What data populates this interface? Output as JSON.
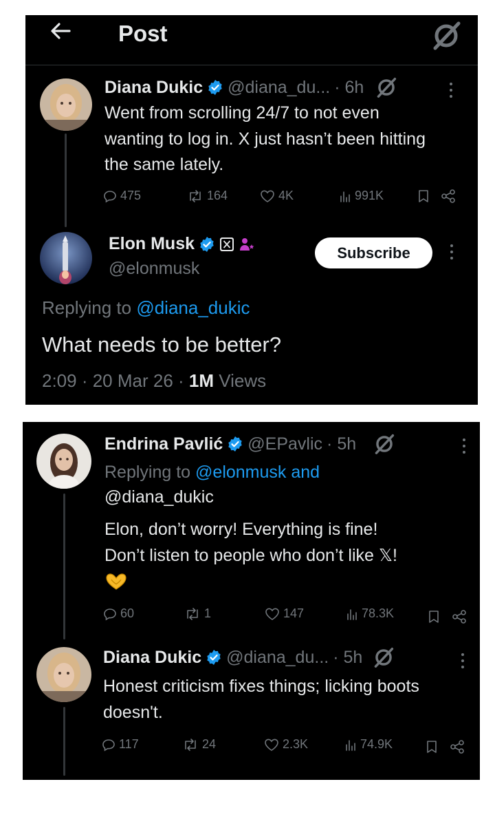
{
  "header": {
    "back_label": "←",
    "title": "Post"
  },
  "tweet1": {
    "name": "Diana Dukic",
    "handle": "@diana_du...",
    "time": "· 6h",
    "text": "Went from scrolling 24/7 to not even wanting to log in. X just hasn’t been hitting the same lately.",
    "replies": "475",
    "reposts": "164",
    "likes": "4K",
    "views": "991K"
  },
  "main": {
    "name": "Elon Musk",
    "handle": "@elonmusk",
    "subscribe_label": "Subscribe",
    "replying_prefix": "Replying to",
    "replying_handle": "@diana_dukic",
    "text": "What needs to be better?",
    "time": "2:09 · 20 Mar 26 ·",
    "views_count": "1M",
    "views_label": "Views"
  },
  "reply1": {
    "name": "Endrina Pavlić",
    "handle": "@EPavlic",
    "time": "· 5h",
    "replying_prefix": "Replying to",
    "replying_handle1": "@elonmusk",
    "replying_and": "and",
    "replying_handle2": "@diana_dukic",
    "text_line1": "Elon, don’t worry! Everything is fine!",
    "text_line2": "Don’t listen to people who don’t like 𝕏!",
    "emoji": "🫶",
    "replies": "60",
    "reposts": "1",
    "likes": "147",
    "views": "78.3K"
  },
  "reply2": {
    "name": "Diana Dukic",
    "handle": "@diana_du...",
    "time": "· 5h",
    "text": "Honest criticism fixes things; licking boots doesn't.",
    "replies": "117",
    "reposts": "24",
    "likes": "2.3K",
    "views": "74.9K"
  },
  "colors": {
    "background": "#000000",
    "text": "#e7e9ea",
    "muted": "#71767b",
    "link": "#1d9bf0",
    "verified": "#1d9bf0",
    "affiliate": "#c43ec9"
  },
  "icons": [
    "back-arrow-icon",
    "grok-icon",
    "verified-badge-icon",
    "reply-icon",
    "repost-icon",
    "like-icon",
    "views-icon",
    "bookmark-icon",
    "share-icon",
    "more-icon",
    "x-logo-badge-icon",
    "affiliate-icon"
  ]
}
